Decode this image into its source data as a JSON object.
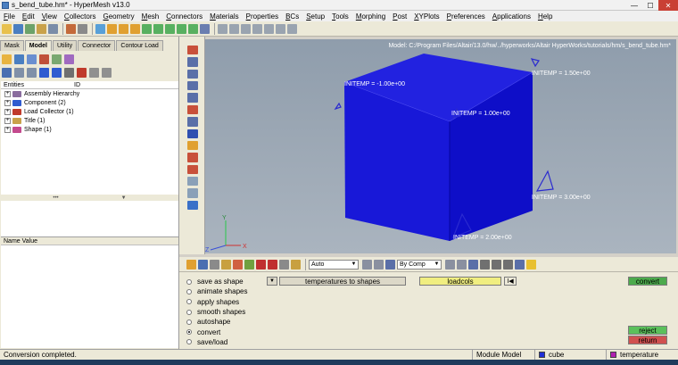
{
  "window": {
    "title": "s_bend_tube.hm* - HyperMesh v13.0",
    "controls": [
      "—",
      "☐",
      "✕"
    ]
  },
  "menu": [
    "File",
    "Edit",
    "View",
    "Collectors",
    "Geometry",
    "Mesh",
    "Connectors",
    "Materials",
    "Properties",
    "BCs",
    "Setup",
    "Tools",
    "Morphing",
    "Post",
    "XYPlots",
    "Preferences",
    "Applications",
    "Help"
  ],
  "left_tabs": [
    "Mask",
    "Model",
    "Utility",
    "Connector",
    "Contour Load"
  ],
  "entities_header": {
    "col1": "Entities",
    "col2": "ID"
  },
  "tree": [
    {
      "label": "Assembly Hierarchy",
      "color": "#8a6d9e"
    },
    {
      "label": "Component (2)",
      "color": "#2f5bd0"
    },
    {
      "label": "Load Collector (1)",
      "color": "#c03a2b"
    },
    {
      "label": "Title (1)",
      "color": "#c9a24a"
    },
    {
      "label": "Shape (1)",
      "color": "#c44a8e"
    }
  ],
  "name_value_header": "Name Value",
  "viewport": {
    "path": "Model: C:/Program Files/Altair/13.0/hw/../hyperworks/Altair HyperWorks/tutorials/hm/s_bend_tube.hm*",
    "labels": [
      "INITEMP = -1.00e+00",
      "INITEMP = 1.50e+00",
      "INITEMP = 1.00e+00",
      "INITEMP = 3.00e+00",
      "INITEMP = 2.00e+00"
    ],
    "axis": {
      "x": "X",
      "y": "Y",
      "z": "Z"
    }
  },
  "bottom_toolbar": {
    "auto_combo": "Auto",
    "bycomp_combo": "By Comp"
  },
  "panel": {
    "options": [
      "save as shape",
      "animate shapes",
      "apply shapes",
      "smooth shapes",
      "autoshape",
      "convert",
      "save/load"
    ],
    "selected_option": "convert",
    "temperatures_button": "temperatures to shapes",
    "loadcols_button": "loadcols",
    "convert_button": "convert",
    "reject_button": "reject",
    "return_button": "return"
  },
  "status": {
    "message": "Conversion completed.",
    "module": "Module Model",
    "component": "cube",
    "loadcol": "temperature",
    "component_color": "#1f2fd6",
    "loadcol_color": "#b020b0"
  }
}
